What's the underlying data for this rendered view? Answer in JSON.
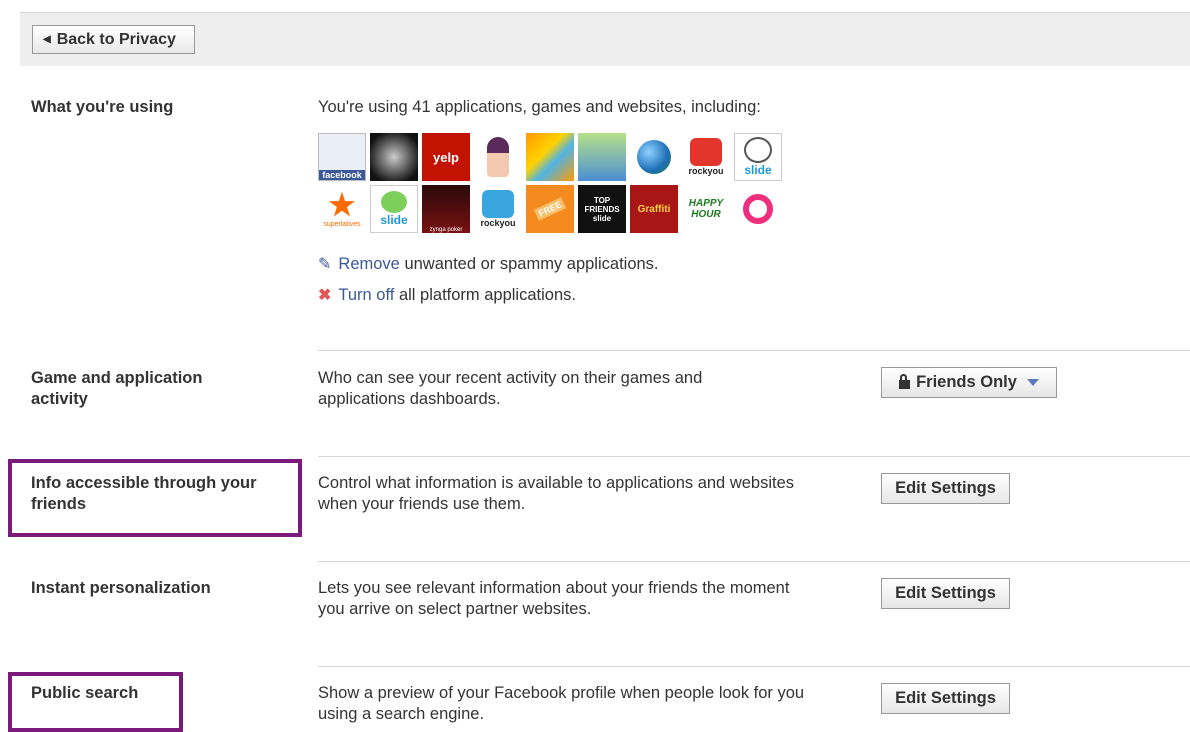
{
  "back_button": {
    "label": "Back to Privacy",
    "icon": "left-triangle-icon"
  },
  "sections": {
    "using": {
      "title": "What you're using",
      "description": "You're using 41 applications, games and websites, including:",
      "app_icons_row1": [
        "facebook",
        "",
        "yelp",
        "",
        "",
        "",
        "",
        "rockyou",
        "slide"
      ],
      "app_icons_row2": [
        "superlatives",
        "slide",
        "zynga poker",
        "rockyou",
        "FREE",
        "TOP FRIENDS slide",
        "Graffiti",
        "HAPPY HOUR",
        ""
      ],
      "remove_link": "Remove",
      "remove_text": "unwanted or spammy applications.",
      "turnoff_link": "Turn off",
      "turnoff_text": "all platform applications."
    },
    "game_activity": {
      "title": "Game and application activity",
      "description": "Who can see your recent activity on their games and applications dashboards.",
      "dropdown_value": "Friends Only"
    },
    "info_friends": {
      "title": "Info accessible through your friends",
      "description": "Control what information is available to applications and websites when your friends use them.",
      "button": "Edit Settings"
    },
    "instant": {
      "title": "Instant personalization",
      "description": "Lets you see relevant information about your friends the moment you arrive on select partner websites.",
      "button": "Edit Settings"
    },
    "public_search": {
      "title": "Public search",
      "description": "Show a preview of your Facebook profile when people look for you using a search engine.",
      "button": "Edit Settings"
    }
  },
  "colors": {
    "link": "#3b5998",
    "highlight": "#7b1a7b"
  }
}
